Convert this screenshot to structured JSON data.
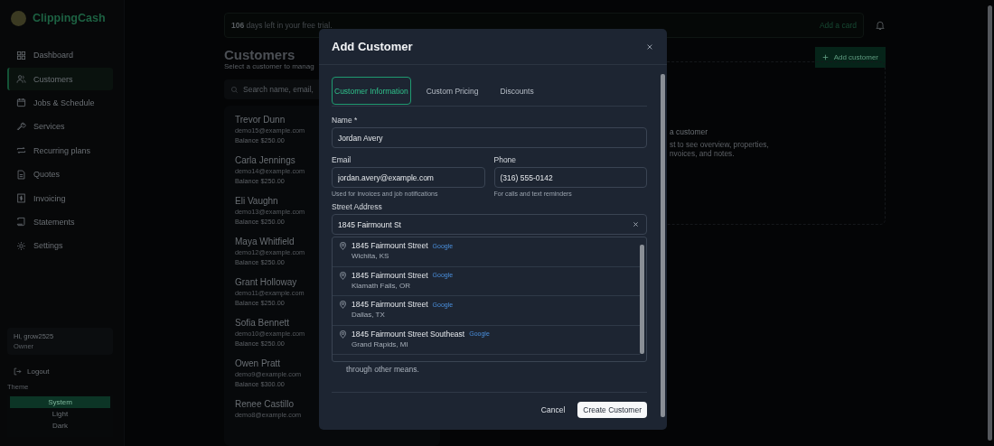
{
  "sidebar": {
    "brand": "ClippingCash",
    "nav": [
      {
        "label": "Dashboard",
        "selected": false
      },
      {
        "label": "Customers",
        "selected": true
      },
      {
        "label": "Jobs & Schedule",
        "selected": false
      },
      {
        "label": "Services",
        "selected": false
      },
      {
        "label": "Recurring plans",
        "selected": false
      },
      {
        "label": "Quotes",
        "selected": false
      },
      {
        "label": "Invoicing",
        "selected": false
      },
      {
        "label": "Statements",
        "selected": false
      },
      {
        "label": "Settings",
        "selected": false
      }
    ],
    "user": {
      "greeting": "Hi, grow2525",
      "role": "Owner"
    },
    "logout": "Logout",
    "theme": {
      "label": "Theme",
      "options": [
        {
          "label": "System",
          "selected": true
        },
        {
          "label": "Light",
          "selected": false
        },
        {
          "label": "Dark",
          "selected": false
        }
      ]
    }
  },
  "trial_banner": {
    "days": "106",
    "text": "days left in your free trial.",
    "action": "Add a card"
  },
  "page": {
    "title": "Customers",
    "subtitle": "Select a customer to manag",
    "search": {
      "placeholder": "Search name, email,"
    },
    "add_button": "Add customer"
  },
  "customers": [
    {
      "name": "Trevor Dunn",
      "email": "demo15@example.com",
      "balance": "Balance $250.00"
    },
    {
      "name": "Carla Jennings",
      "email": "demo14@example.com",
      "balance": "Balance $250.00"
    },
    {
      "name": "Eli Vaughn",
      "email": "demo13@example.com",
      "balance": "Balance $250.00"
    },
    {
      "name": "Maya Whitfield",
      "email": "demo12@example.com",
      "balance": "Balance $250.00"
    },
    {
      "name": "Grant Holloway",
      "email": "demo11@example.com",
      "balance": "Balance $250.00"
    },
    {
      "name": "Sofia Bennett",
      "email": "demo10@example.com",
      "balance": "Balance $250.00"
    },
    {
      "name": "Owen Pratt",
      "email": "demo9@example.com",
      "balance": "Balance $300.00"
    },
    {
      "name": "Renee Castillo",
      "email": "demo8@example.com"
    }
  ],
  "detail_panel": {
    "title": "a customer",
    "text": "st to see overview, properties,",
    "text_2": "nvoices, and notes."
  },
  "modal": {
    "title": "Add Customer",
    "tabs": [
      {
        "label": "Customer Information",
        "selected": true
      },
      {
        "label": "Custom Pricing",
        "selected": false
      },
      {
        "label": "Discounts",
        "selected": false
      }
    ],
    "name": {
      "label": "Name *",
      "value": "Jordan Avery"
    },
    "email": {
      "label": "Email",
      "value": "jordan.avery@example.com",
      "help": "Used for invoices and job notifications"
    },
    "phone": {
      "label": "Phone",
      "value": "(316) 555-0142",
      "help": "For calls and text reminders"
    },
    "address": {
      "label": "Street Address",
      "value": "1845 Fairmount St",
      "suggestions": [
        {
          "street": "1845 Fairmount Street",
          "source": "Google",
          "locality": "Wichita, KS"
        },
        {
          "street": "1845 Fairmount Street",
          "source": "Google",
          "locality": "Klamath Falls, OR"
        },
        {
          "street": "1845 Fairmount Street",
          "source": "Google",
          "locality": "Dallas, TX"
        },
        {
          "street": "1845 Fairmount Street Southeast",
          "source": "Google",
          "locality": "Grand Rapids, MI"
        }
      ]
    },
    "note": "through other means.",
    "cancel": "Cancel",
    "submit": "Create Customer"
  }
}
